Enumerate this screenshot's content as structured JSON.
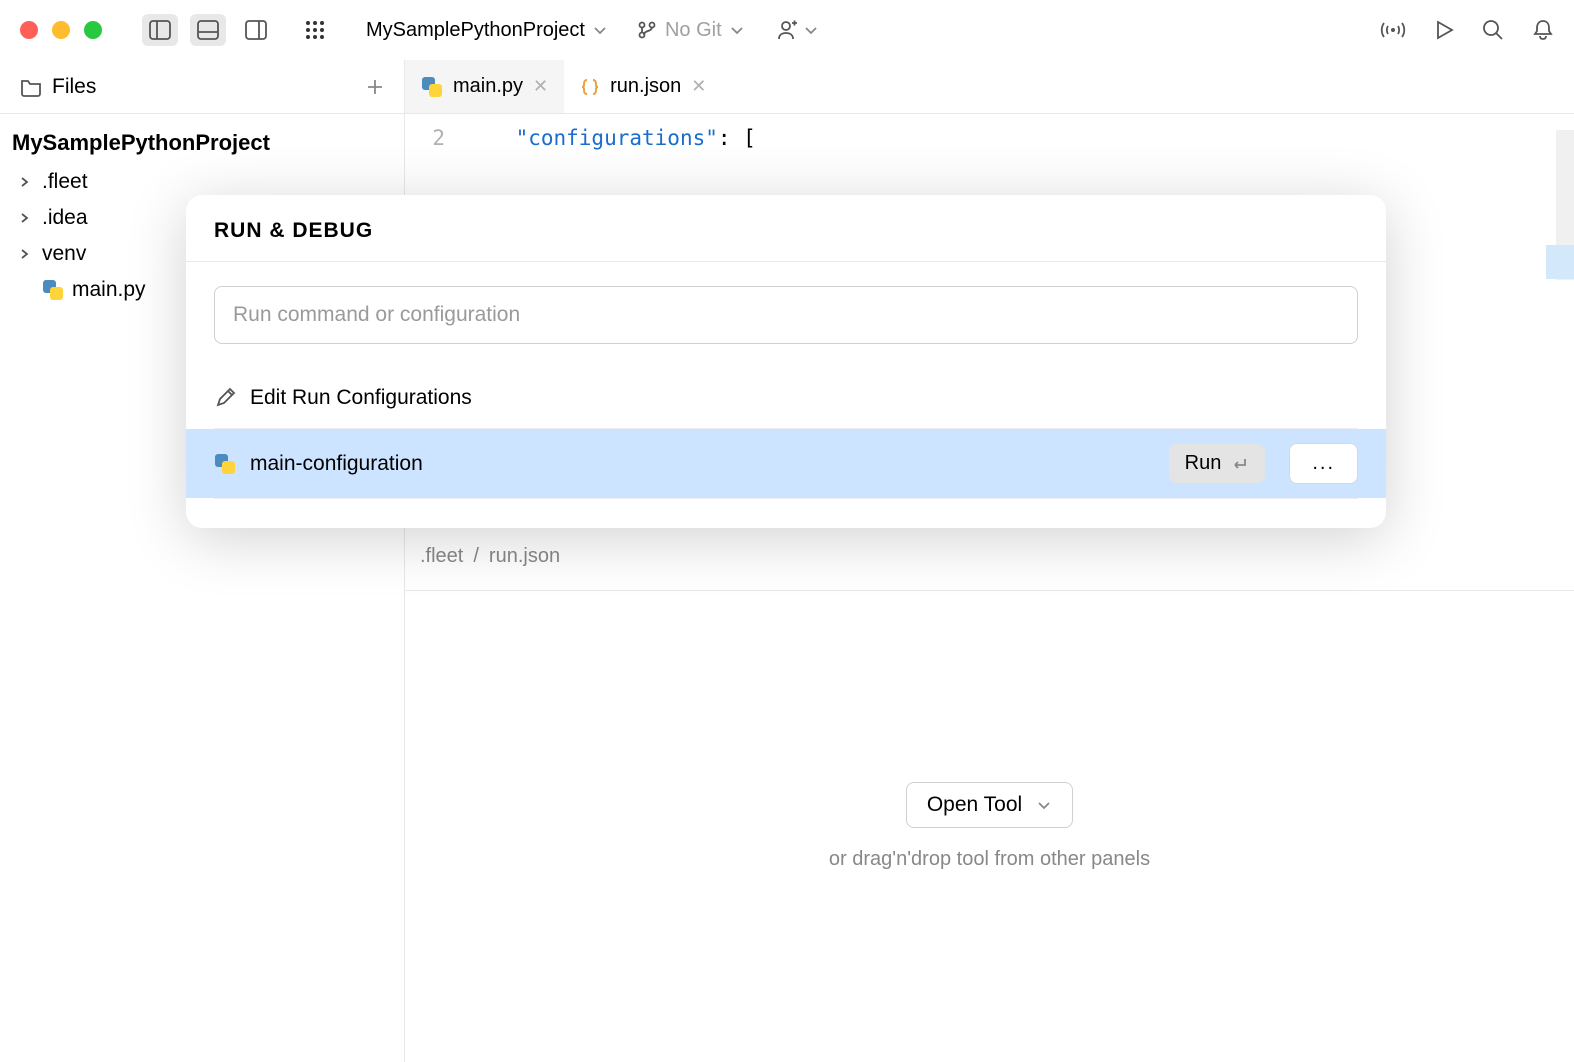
{
  "titlebar": {
    "project_name": "MySamplePythonProject",
    "git_label": "No Git"
  },
  "sidebar": {
    "tab_label": "Files",
    "project_name": "MySamplePythonProject",
    "tree": [
      {
        "label": ".fleet",
        "has_children": true
      },
      {
        "label": ".idea",
        "has_children": true
      },
      {
        "label": "venv",
        "has_children": true
      },
      {
        "label": "main.py",
        "has_children": false,
        "icon": "python"
      }
    ]
  },
  "editor": {
    "tabs": [
      {
        "label": "main.py",
        "icon": "python",
        "active": false
      },
      {
        "label": "run.json",
        "icon": "json",
        "active": true
      }
    ],
    "line_number": "2",
    "code_key": "\"configurations\"",
    "code_rest": ": [",
    "breadcrumb": [
      ".fleet",
      "/",
      "run.json"
    ]
  },
  "rundebug": {
    "title": "RUN & DEBUG",
    "placeholder": "Run command or configuration",
    "edit_label": "Edit Run Configurations",
    "config_name": "main-configuration",
    "run_label": "Run",
    "more_label": "..."
  },
  "bottom": {
    "button_label": "Open Tool",
    "hint": "or drag'n'drop tool from other panels"
  }
}
